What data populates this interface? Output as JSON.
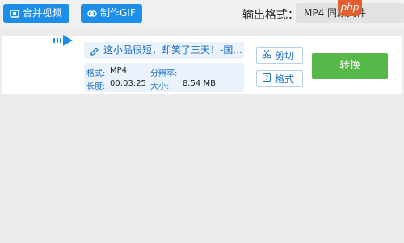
{
  "toolbar": {
    "merge_label": "合并视频",
    "gif_label": "制作GIF",
    "output_format_label": "输出格式：",
    "output_format_value": "MP4  同原文件",
    "badge": "php"
  },
  "file": {
    "title": "这小品很短，却笑了三天！-国...",
    "format_label": "格式:",
    "format_value": "MP4",
    "resolution_label": "分辨率:",
    "duration_label": "长度:",
    "duration_value": "00:03:25",
    "size_label": "大小:",
    "size_value": "8.54 MB"
  },
  "actions": {
    "cut_label": "剪切",
    "format_label": "格式",
    "convert_label": "转换"
  },
  "colors": {
    "primary_blue": "#1e8fe9",
    "convert_green": "#57b84a",
    "info_blue": "#1e6fc0"
  },
  "icons": {
    "merge": "merge-icon",
    "gif": "link-icon",
    "play": "play-arrow-icon",
    "edit": "pencil-icon",
    "cut": "scissors-icon",
    "format": "format-icon"
  }
}
